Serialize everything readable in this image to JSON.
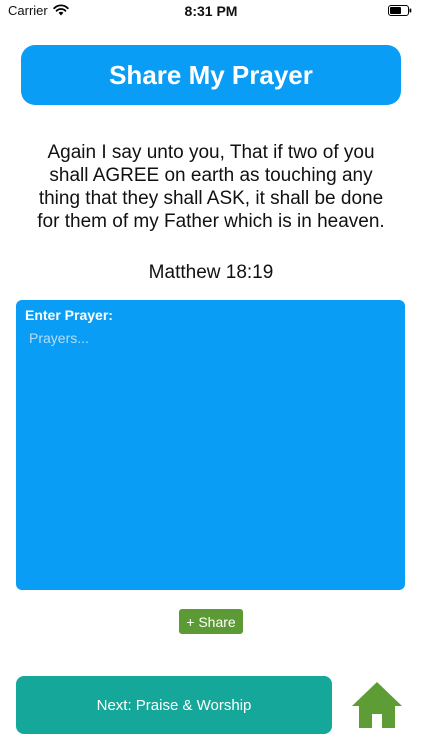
{
  "status_bar": {
    "carrier": "Carrier",
    "time": "8:31 PM"
  },
  "title": "Share My Prayer",
  "verse": {
    "text": "Again I say unto you, That if two of you shall AGREE on earth as touching any thing that they shall ASK, it shall be done for them of my Father which is in heaven.",
    "reference": "Matthew 18:19"
  },
  "prayer": {
    "label": "Enter Prayer:",
    "placeholder": "Prayers...",
    "value": ""
  },
  "share_button": "+ Share",
  "next_button": "Next: Praise & Worship",
  "icons": {
    "wifi": "wifi-icon",
    "battery": "battery-icon",
    "home": "home-icon"
  },
  "colors": {
    "primary_blue": "#0a9df5",
    "share_green": "#5b9a35",
    "next_teal": "#15a79a",
    "home_green": "#5e9d36"
  }
}
